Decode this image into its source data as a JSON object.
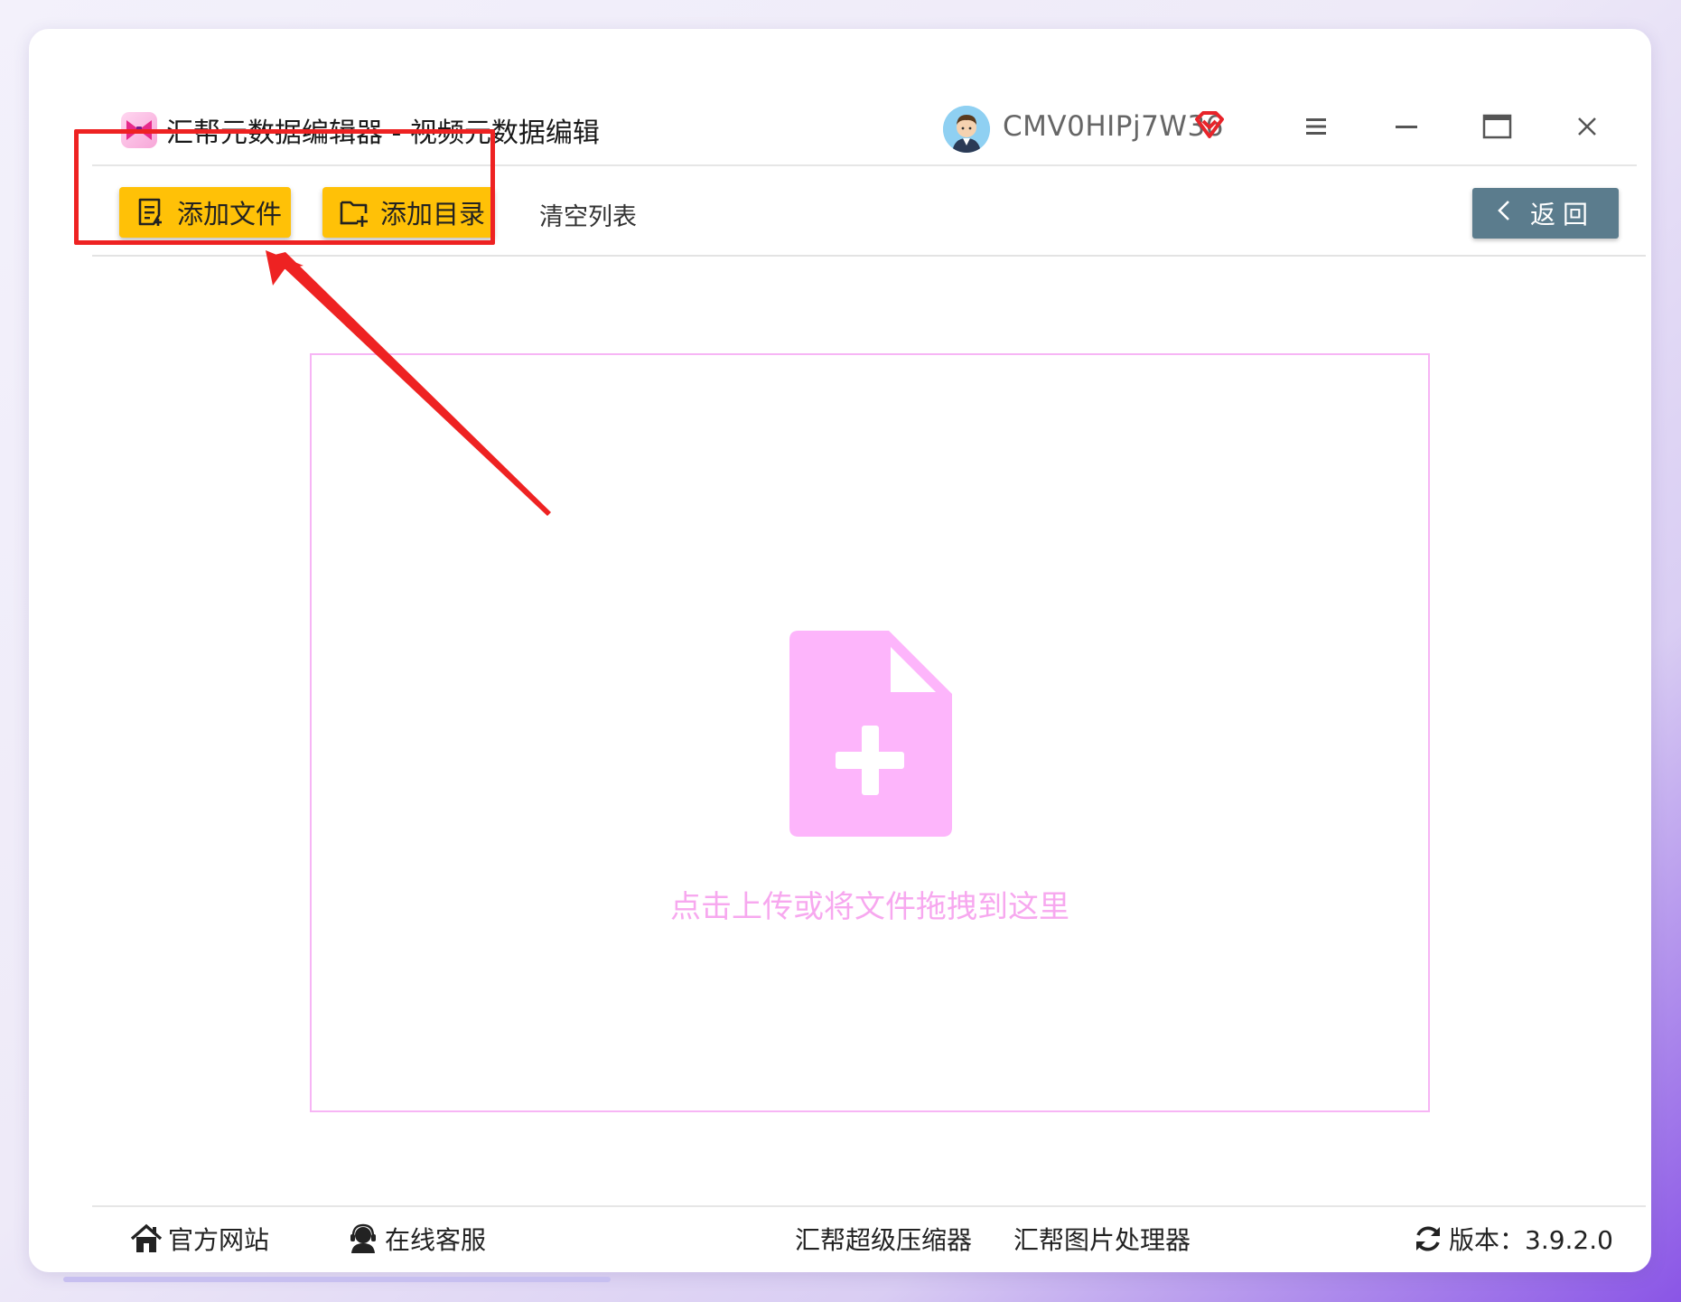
{
  "window": {
    "title": "汇帮元数据编辑器 - 视频元数据编辑",
    "username": "CMV0HIPj7W36",
    "icons": {
      "logo": "bow-logo-icon",
      "avatar": "user-avatar",
      "vip": "vip-diamond-icon",
      "menu": "hamburger-menu-icon",
      "minimize": "minimize-icon",
      "maximize": "maximize-icon",
      "close": "close-icon"
    }
  },
  "toolbar": {
    "add_file_label": "添加文件",
    "add_dir_label": "添加目录",
    "clear_label": "清空列表",
    "back_label": "返回"
  },
  "dropzone": {
    "hint": "点击上传或将文件拖拽到这里"
  },
  "footer": {
    "official_site": "官方网站",
    "online_service": "在线客服",
    "compressor": "汇帮超级压缩器",
    "image_processor": "汇帮图片处理器",
    "version": "版本：3.9.2.0"
  },
  "colors": {
    "accent_yellow": "#ffc107",
    "back_button": "#5b7c8d",
    "dropzone_pink": "#f7b5f5",
    "highlight_red": "#ee2222"
  }
}
